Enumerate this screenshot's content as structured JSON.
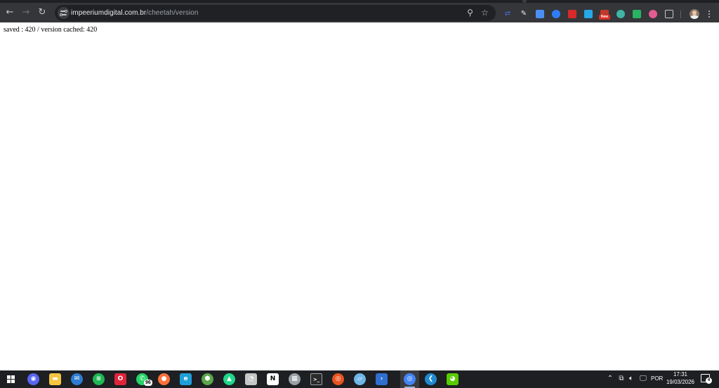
{
  "browser": {
    "address_bar": {
      "host": "impeeriumdigital.com.br",
      "path": "/cheetah/version"
    },
    "nav": {
      "back_icon": "arrow-left-icon",
      "forward_icon": "arrow-right-icon",
      "reload_icon": "reload-icon"
    },
    "omnibox_actions": [
      "zoom-icon",
      "bookmark-star-icon"
    ],
    "extensions": [
      {
        "name": "extension-arrows-icon",
        "color": "#4b6cd9"
      },
      {
        "name": "extension-eyedropper-icon",
        "color": "#e8eaed"
      },
      {
        "name": "extension-tag-icon",
        "color": "#4b8ff5"
      },
      {
        "name": "extension-circle-icon",
        "color": "#2f7df6"
      },
      {
        "name": "extension-red-square-icon",
        "color": "#d92929"
      },
      {
        "name": "extension-play-icon",
        "color": "#25a8e8"
      },
      {
        "name": "extension-new-icon",
        "color": "#c0392b",
        "badge": "New"
      },
      {
        "name": "extension-snowflake-icon",
        "color": "#3fb5a5"
      },
      {
        "name": "extension-tree-icon",
        "color": "#28b463"
      },
      {
        "name": "extension-multicolor-icon",
        "color": "#e35b8f"
      },
      {
        "name": "extensions-puzzle-icon",
        "color": "#c4c7c5"
      }
    ]
  },
  "page": {
    "text": "saved : 420 / version cached: 420"
  },
  "taskbar": {
    "apps": [
      {
        "name": "discord-icon",
        "color": "#5865f2",
        "glyph": "◉"
      },
      {
        "name": "file-explorer-icon",
        "color": "#f4c542",
        "glyph": "▬"
      },
      {
        "name": "mail-icon",
        "color": "#2d7cd3",
        "glyph": "✉"
      },
      {
        "name": "spotify-icon",
        "color": "#1db954",
        "glyph": "≋"
      },
      {
        "name": "opera-icon",
        "color": "#e0243a",
        "glyph": "O"
      },
      {
        "name": "whatsapp-icon",
        "color": "#25d366",
        "glyph": "✆"
      },
      {
        "name": "firefox-icon",
        "color": "#ff7139",
        "glyph": "●"
      },
      {
        "name": "edge-icon",
        "color": "#1f9fd8",
        "glyph": "e"
      },
      {
        "name": "minecraft-icon",
        "color": "#5aa64a",
        "glyph": "⬢"
      },
      {
        "name": "pycharm-icon",
        "color": "#21d789",
        "glyph": "▲"
      },
      {
        "name": "settings-clock-icon",
        "color": "#c4c7c5",
        "glyph": "◔"
      },
      {
        "name": "notion-icon",
        "color": "#ffffff",
        "glyph": "N"
      },
      {
        "name": "calculator-icon",
        "color": "#9aa0a6",
        "glyph": "▦"
      },
      {
        "name": "terminal-icon",
        "color": "#2b2b2b",
        "glyph": ">_"
      },
      {
        "name": "ubuntu-icon",
        "color": "#e95420",
        "glyph": "◎"
      },
      {
        "name": "notes-icon",
        "color": "#6fb6e8",
        "glyph": "▱"
      },
      {
        "name": "powershell-icon",
        "color": "#2f6fd0",
        "glyph": "›"
      },
      {
        "name": "chrome-icon",
        "color": "#4285f4",
        "glyph": "◎"
      },
      {
        "name": "vscode-icon",
        "color": "#1f8ad2",
        "glyph": "❮"
      },
      {
        "name": "duolingo-icon",
        "color": "#58cc02",
        "glyph": "◕"
      }
    ],
    "whatsapp_badge": "96",
    "tray": {
      "language": "POR",
      "time": "17:31",
      "date": "19/03/2026",
      "notifications": "4"
    }
  }
}
